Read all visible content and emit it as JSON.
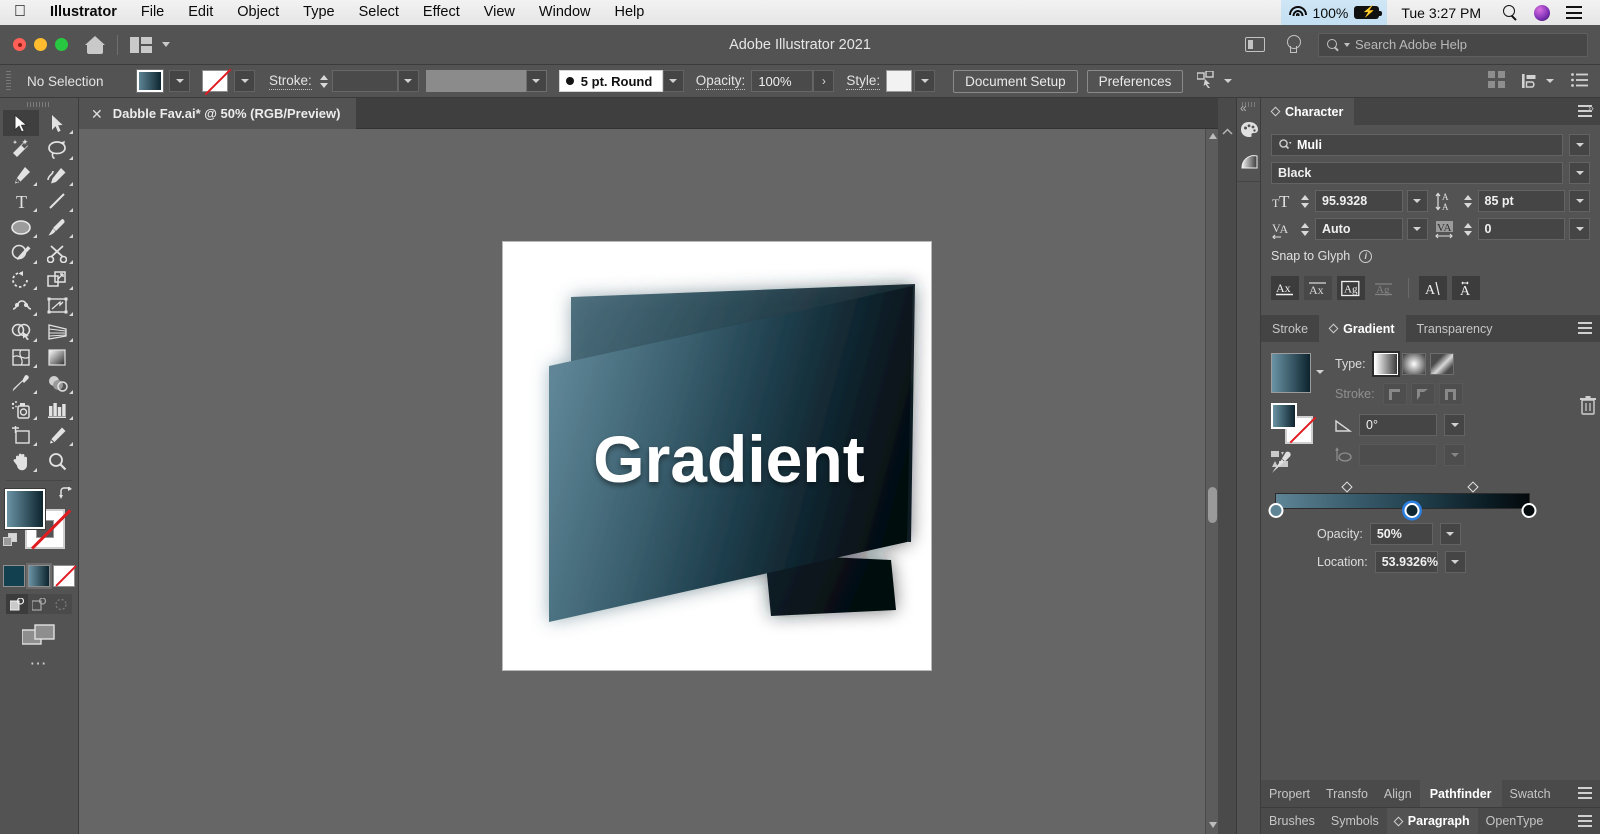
{
  "macmenu": {
    "apple": "apple-logo",
    "items": [
      "Illustrator",
      "File",
      "Edit",
      "Object",
      "Type",
      "Select",
      "Effect",
      "View",
      "Window",
      "Help"
    ],
    "status": {
      "battery_percent": "100%",
      "clock": "Tue 3:27 PM"
    }
  },
  "titlebar": {
    "app_title": "Adobe Illustrator 2021",
    "help_placeholder": "Search Adobe Help"
  },
  "optionsbar": {
    "selection_status": "No Selection",
    "stroke_label": "Stroke:",
    "stroke_weight": "",
    "brush_def": "5 pt. Round",
    "opacity_label": "Opacity:",
    "opacity_value": "100%",
    "style_label": "Style:",
    "document_setup": "Document Setup",
    "preferences": "Preferences"
  },
  "document": {
    "tab_title": "Dabble Fav.ai* @ 50% (RGB/Preview)",
    "artwork_text": "Gradient",
    "zoom": "50%",
    "color_mode": "RGB/Preview"
  },
  "character_panel": {
    "title": "Character",
    "font_family": "Muli",
    "font_style": "Black",
    "font_size": "95.9328",
    "leading": "85 pt",
    "kerning": "Auto",
    "tracking": "0",
    "snap_to_glyph": "Snap to Glyph",
    "glyph_buttons": [
      "Ax",
      "A̅x",
      "Ag",
      "Ag",
      "A",
      "A"
    ]
  },
  "gradient_panel": {
    "tabs": [
      "Stroke",
      "Gradient",
      "Transparency"
    ],
    "active_tab": "Gradient",
    "type_label": "Type:",
    "stroke_label": "Stroke:",
    "angle": "0°",
    "aspect_ratio": "",
    "opacity_label": "Opacity:",
    "opacity_value": "50%",
    "location_label": "Location:",
    "location_value": "53.9326%",
    "stops": [
      {
        "position": 0,
        "color": "#5e8596",
        "selected": false
      },
      {
        "position": 53.9326,
        "color": "#233f4d",
        "selected": true
      },
      {
        "position": 100,
        "color": "#050a0d",
        "selected": false
      }
    ],
    "midpoints": [
      28,
      78
    ]
  },
  "bottom_tabs": {
    "row1": [
      "Propert",
      "Transfo",
      "Align",
      "Pathfinder",
      "Swatch"
    ],
    "row1_active": "Pathfinder",
    "row2": [
      "Brushes",
      "Symbols",
      "Paragraph",
      "OpenType"
    ],
    "row2_active": "Paragraph"
  },
  "toolbar": {
    "tools": [
      "selection-tool",
      "direct-selection-tool",
      "magic-wand-tool",
      "lasso-tool",
      "pen-tool",
      "curvature-tool",
      "type-tool",
      "line-segment-tool",
      "ellipse-tool",
      "paintbrush-tool",
      "shaper-tool",
      "scissors-tool",
      "rotate-tool",
      "scale-tool",
      "width-tool",
      "free-transform-tool",
      "shape-builder-tool",
      "perspective-grid-tool",
      "mesh-tool",
      "gradient-tool",
      "eyedropper-tool",
      "blend-tool",
      "symbol-sprayer-tool",
      "column-graph-tool",
      "artboard-tool",
      "slice-tool",
      "hand-tool",
      "zoom-tool"
    ],
    "active_tool": "selection-tool",
    "fill_color": "gradient",
    "stroke_color": "none"
  },
  "colors": {
    "ui_background": "#535353",
    "panel_background": "#444444",
    "canvas": "#666666",
    "accent_blue": "#2b7fe0",
    "gradient_start": "#5e8596",
    "gradient_end": "#05090c"
  }
}
